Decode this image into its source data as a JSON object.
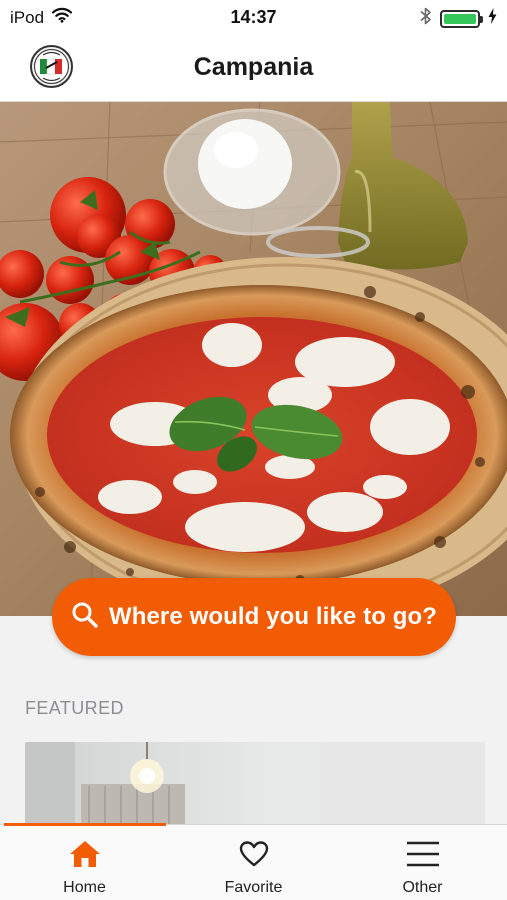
{
  "status_bar": {
    "carrier": "iPod",
    "time": "14:37"
  },
  "nav": {
    "title": "Campania"
  },
  "search": {
    "label": "Where would you like to go?"
  },
  "featured": {
    "section_title": "FEATURED"
  },
  "tabs": [
    {
      "label": "Home",
      "icon": "home-icon",
      "active": true
    },
    {
      "label": "Favorite",
      "icon": "heart-icon",
      "active": false
    },
    {
      "label": "Other",
      "icon": "menu-icon",
      "active": false
    }
  ],
  "colors": {
    "accent": "#f25c05",
    "battery": "#35c759"
  }
}
